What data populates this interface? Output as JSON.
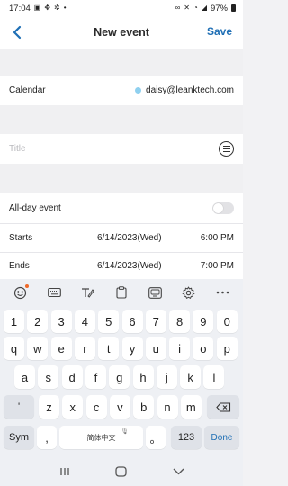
{
  "status_bar": {
    "time": "17:04",
    "battery": "97%"
  },
  "header": {
    "title": "New event",
    "save_label": "Save"
  },
  "calendar": {
    "label": "Calendar",
    "account": "daisy@leanktech.com",
    "color": "#8fd0ef"
  },
  "title_field": {
    "placeholder": "Title",
    "value": ""
  },
  "all_day": {
    "label": "All-day event",
    "enabled": false
  },
  "starts": {
    "label": "Starts",
    "date": "6/14/2023(Wed)",
    "time": "6:00 PM"
  },
  "ends": {
    "label": "Ends",
    "date": "6/14/2023(Wed)",
    "time": "7:00 PM"
  },
  "keyboard": {
    "number_row": [
      "1",
      "2",
      "3",
      "4",
      "5",
      "6",
      "7",
      "8",
      "9",
      "0"
    ],
    "row1": [
      "q",
      "w",
      "e",
      "r",
      "t",
      "y",
      "u",
      "i",
      "o",
      "p"
    ],
    "row2": [
      "a",
      "s",
      "d",
      "f",
      "g",
      "h",
      "j",
      "k",
      "l"
    ],
    "row3": [
      "z",
      "x",
      "c",
      "v",
      "b",
      "n",
      "m"
    ],
    "apostrophe": "'",
    "sym_label": "Sym",
    "comma": ",",
    "space_label": "简体中文",
    "period": "。",
    "num_label": "123",
    "done_label": "Done"
  },
  "colors": {
    "accent": "#1f6fb5",
    "notification_dot": "#ef6a2a"
  }
}
